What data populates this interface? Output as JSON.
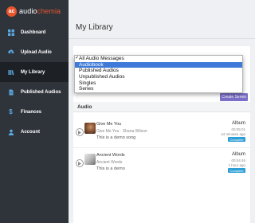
{
  "brand": {
    "mark": "ac",
    "name_part1": "audio",
    "name_part2": "chemia"
  },
  "sidebar": {
    "items": [
      {
        "label": "Dashboard",
        "icon": "grid-icon",
        "active": false
      },
      {
        "label": "Upload Audio",
        "icon": "upload-icon",
        "active": false
      },
      {
        "label": "My Library",
        "icon": "library-icon",
        "active": true
      },
      {
        "label": "Published Audios",
        "icon": "document-icon",
        "active": false
      },
      {
        "label": "Finances",
        "icon": "dollar-icon",
        "active": false
      },
      {
        "label": "Account",
        "icon": "user-icon",
        "active": false
      }
    ]
  },
  "main": {
    "title": "My Library",
    "filter": {
      "selected": "All Audio Messages",
      "options": [
        "All Audio Messages",
        "Audiobook",
        "Published Audios",
        "Unpublished Audios",
        "Singles",
        "Series"
      ],
      "highlighted_index": 1
    },
    "create_button": "Create Series",
    "section_label": "Audio",
    "rows": [
      {
        "title": "Give Me You",
        "subtitle": "Give Me You · Shana Wilson",
        "description": "This is a demo song",
        "type": "Album",
        "duration": "00:05:01",
        "ago": "44 minutes ago",
        "status": "Complete"
      },
      {
        "title": "Ancient Words",
        "subtitle": "Ancient Words",
        "description": "This is a demo",
        "type": "Album",
        "duration": "00:04:46",
        "ago": "1 hour ago",
        "status": "Complete"
      }
    ]
  },
  "colors": {
    "sidebar_bg": "#2f343b",
    "accent": "#e8552c",
    "badge": "#2e9fd6",
    "button": "#7b6ec9",
    "highlight": "#3f7ad8"
  }
}
